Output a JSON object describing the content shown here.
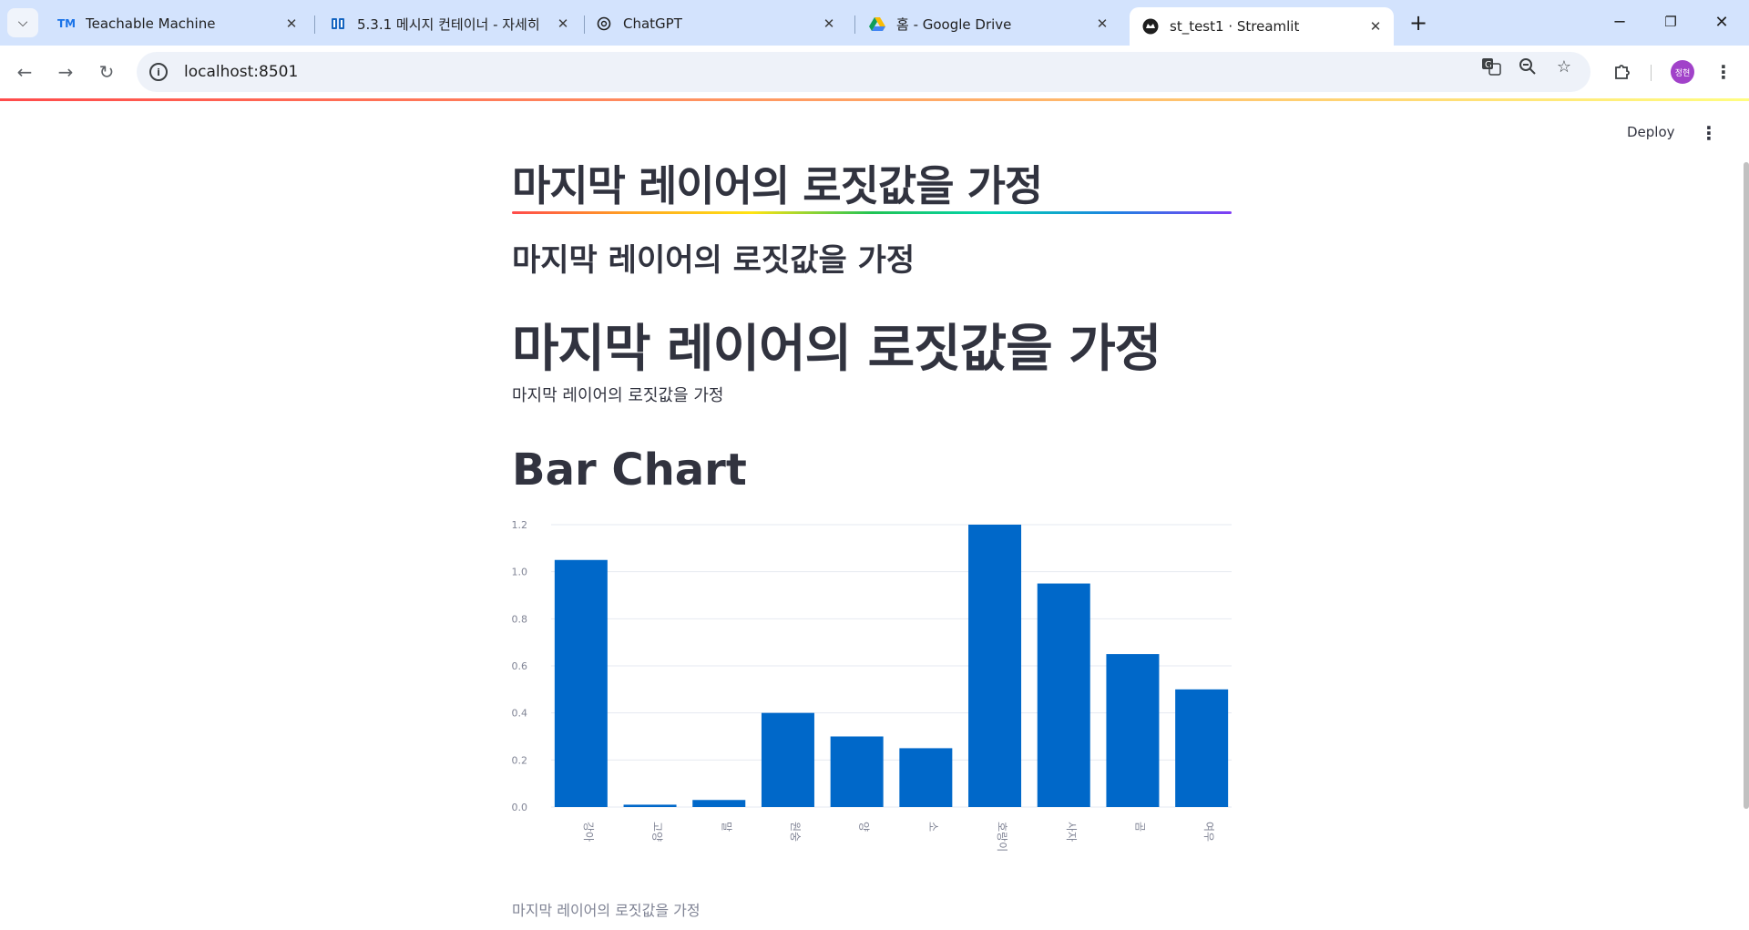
{
  "browser": {
    "tabs": [
      {
        "title": "Teachable Machine",
        "favicon": "TM",
        "active": false
      },
      {
        "title": "5.3.1 메시지 컨테이너 - 자세히",
        "favicon": "book-icon",
        "active": false
      },
      {
        "title": "ChatGPT",
        "favicon": "chatgpt-icon",
        "active": false
      },
      {
        "title": "홈 - Google Drive",
        "favicon": "drive-icon",
        "active": false
      },
      {
        "title": "st_test1 · Streamlit",
        "favicon": "streamlit-icon",
        "active": true
      }
    ],
    "url": "localhost:8501",
    "avatar_text": "정현",
    "colors": {
      "tabstrip": "#d3e3fd",
      "omnibox": "#eef2f9",
      "avatar": "#a142c9"
    }
  },
  "app": {
    "deploy_label": "Deploy",
    "title": "마지막 레이어의 로짓값을 가정",
    "subheader": "마지막 레이어의 로짓값을 가정",
    "header": "마지막 레이어의 로짓값을 가정",
    "text": "마지막 레이어의 로짓값을 가정",
    "chart_heading": "Bar Chart",
    "caption": "마지막 레이어의 로짓값을 가정"
  },
  "chart_data": {
    "type": "bar",
    "categories": [
      "강아지",
      "고양이",
      "말",
      "원숭이",
      "양",
      "소",
      "호랑이",
      "사자",
      "곰",
      "여우"
    ],
    "category_labels": [
      "강아",
      "고양",
      "말",
      "원숭",
      "양",
      "소",
      "호랑이",
      "사자",
      "곰",
      "여우"
    ],
    "values": [
      1.05,
      0.01,
      0.03,
      0.4,
      0.3,
      0.25,
      1.2,
      0.95,
      0.65,
      0.5
    ],
    "yticks": [
      "0.0",
      "0.2",
      "0.4",
      "0.6",
      "0.8",
      "1.0",
      "1.2"
    ],
    "ylim": [
      0,
      1.2
    ],
    "grid": true,
    "bar_color": "#0068c9"
  }
}
